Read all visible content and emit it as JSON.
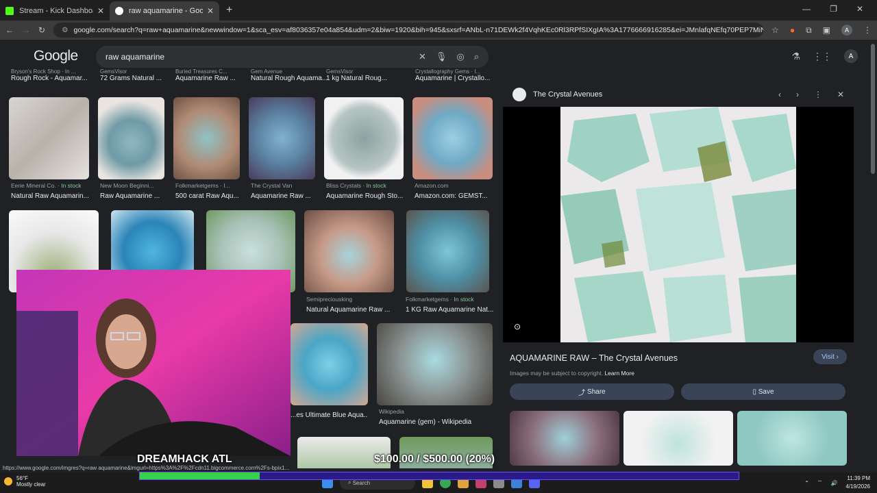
{
  "browser": {
    "tabs": [
      {
        "title": "Stream - Kick Dashboard",
        "active": false,
        "color": "#53fc18"
      },
      {
        "title": "raw aquamarine - Google Search",
        "active": true,
        "color": "#ffffff"
      }
    ],
    "url": "google.com/search?q=raw+aquamarine&newwindow=1&sca_esv=af8036357e04a854&udm=2&biw=1920&bih=945&sxsrf=ANbL-n71DEWk2f4VqhKEc0Rl3RPfSIXgIA%3A1776666916285&ei=JMnlafqNEfq70PEP7MiN0Ao&ved=0ahUKEwj6r..."
  },
  "google": {
    "logo": "Google",
    "query": "raw aquamarine",
    "account_initial": "A"
  },
  "top_row": [
    {
      "source": "Bryson's Rock Shop · In ...",
      "title": "Rough Rock - Aquamar..."
    },
    {
      "source": "GemsVisor",
      "title": "72 Grams Natural ..."
    },
    {
      "source": "Buried Treasures C...",
      "title": "Aquamarine Raw ..."
    },
    {
      "source": "Gem Avenue",
      "title": "Natural Rough Aquama..."
    },
    {
      "source": "GemsVisor",
      "title": "1 kg Natural Roug..."
    },
    {
      "source": "Crystallography Gems · I...",
      "title": "Aquamarine | Crystallo..."
    }
  ],
  "row1": [
    {
      "source": "Eerie Mineral Co.",
      "stock": "In stock",
      "title": "Natural Raw Aquamarin..."
    },
    {
      "source": "New Moon Beginni...",
      "stock": "",
      "title": "Raw Aquamarine ..."
    },
    {
      "source": "Folkmarketgems · I...",
      "stock": "",
      "title": "500 carat Raw Aqu..."
    },
    {
      "source": "The Crystal Van",
      "stock": "",
      "title": "Aquamarine Raw ..."
    },
    {
      "source": "Bliss Crystals",
      "stock": "In stock",
      "title": "Aquamarine Rough Sto..."
    },
    {
      "source": "Amazon.com",
      "stock": "",
      "title": "Amazon.com: GEMST..."
    }
  ],
  "row2": [
    {
      "source": "Semipreciousking",
      "stock": "",
      "title": "Natural Aquamarine Raw ..."
    },
    {
      "source": "Folkmarketgems",
      "stock": "In stock",
      "title": "1 KG Raw Aquamarine Nat..."
    }
  ],
  "row3": [
    {
      "source": "",
      "stock": "",
      "title": "...es Ultimate Blue Aqua..."
    },
    {
      "source": "Wikipedia",
      "stock": "",
      "title": "Aquamarine (gem) - Wikipedia"
    }
  ],
  "panel": {
    "source": "The Crystal Avenues",
    "title": "AQUAMARINE RAW – The Crystal Avenues",
    "visit": "Visit",
    "copyright": "Images may be subject to copyright.",
    "learn_more": "Learn More",
    "share": "Share",
    "save": "Save"
  },
  "overlay": {
    "banner": "DREAMHACK ATL",
    "goal": "$100.00 / $500.00 (20%)",
    "goal_progress": 0.2
  },
  "status_url": "https://www.google.com/imgres?q=raw aquamarine&imgurl=https%3A%2F%2Fcdn11.bigcommerce.com%2Fs-bpix1...",
  "taskbar": {
    "temp": "56°F",
    "weather": "Mostly clear",
    "search": "Search",
    "time": "11:39 PM",
    "date": "4/19/2026"
  }
}
